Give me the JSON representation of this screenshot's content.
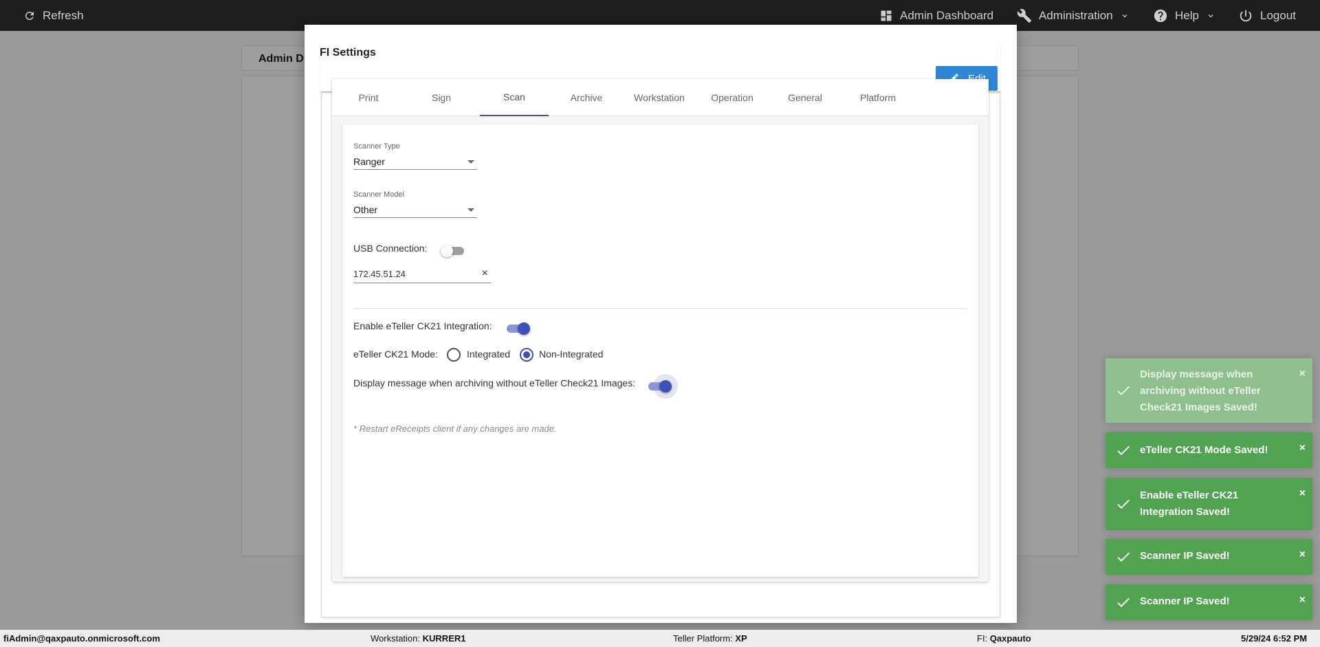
{
  "topbar": {
    "refresh_label": "Refresh",
    "admin_dashboard_label": "Admin Dashboard",
    "administration_label": "Administration",
    "help_label": "Help",
    "logout_label": "Logout"
  },
  "background": {
    "header_text": "Admin D"
  },
  "modal": {
    "title": "FI Settings",
    "edit_label": "Edit",
    "tabs": [
      {
        "label": "Print"
      },
      {
        "label": "Sign"
      },
      {
        "label": "Scan",
        "active": true
      },
      {
        "label": "Archive"
      },
      {
        "label": "Workstation"
      },
      {
        "label": "Operation"
      },
      {
        "label": "General"
      },
      {
        "label": "Platform"
      }
    ],
    "scan": {
      "scanner_type_label": "Scanner Type",
      "scanner_type_value": "Ranger",
      "scanner_model_label": "Scanner Model",
      "scanner_model_value": "Other",
      "usb_label": "USB Connection:",
      "usb_on": false,
      "ip_value": "172.45.51.24",
      "ip_clear_icon": "×",
      "ck21_label": "Enable eTeller CK21 Integration:",
      "ck21_on": true,
      "mode_label": "eTeller CK21 Mode:",
      "mode_options": [
        "Integrated",
        "Non-Integrated"
      ],
      "mode_selected": "Non-Integrated",
      "display_msg_label": "Display message when archiving without eTeller Check21 Images:",
      "display_msg_on": true,
      "note": "* Restart eReceipts client if any changes are made."
    }
  },
  "toasts": [
    {
      "message": "Display message when archiving without eTeller Check21 Images Saved!",
      "faded": true
    },
    {
      "message": "eTeller CK21 Mode Saved!"
    },
    {
      "message": "Enable eTeller CK21 Integration Saved!"
    },
    {
      "message": "Scanner IP Saved!"
    },
    {
      "message": "Scanner IP Saved!"
    }
  ],
  "toast_close_icon": "×",
  "statusbar": {
    "user": "fiAdmin@qaxpauto.onmicrosoft.com",
    "workstation_label": "Workstation:",
    "workstation_value": "KURRER1",
    "platform_label": "Teller Platform:",
    "platform_value": "XP",
    "fi_label": "FI:",
    "fi_value": "Qaxpauto",
    "datetime": "5/29/24 6:52 PM"
  },
  "colors": {
    "accent": "#3f51b5",
    "edit_button": "#2d87d6",
    "toast_success": "#51a351",
    "topbar": "#1e1e1e"
  }
}
